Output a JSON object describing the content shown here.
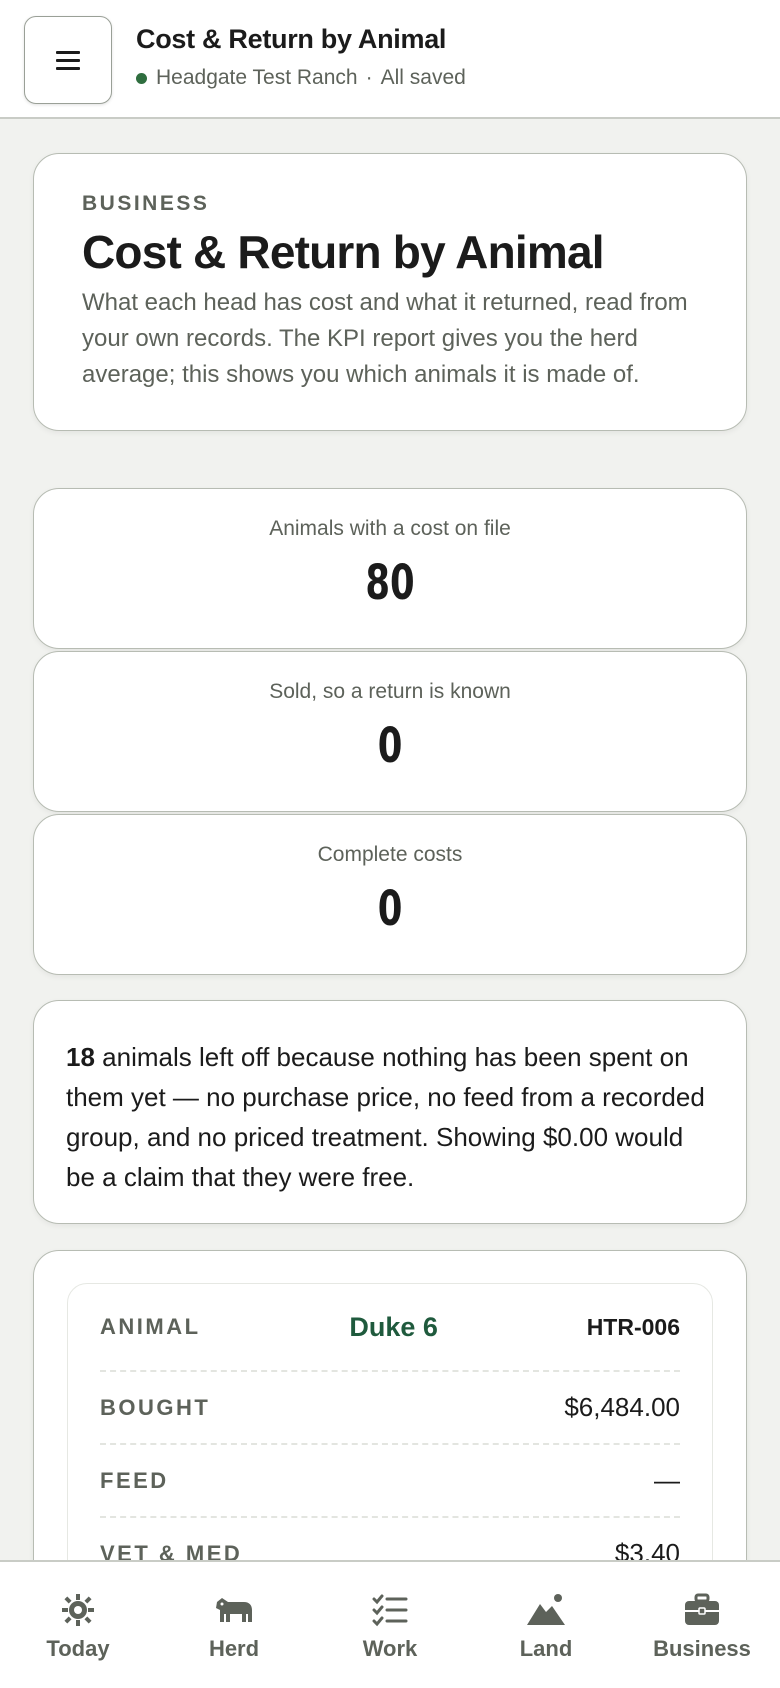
{
  "topbar": {
    "title": "Cost & Return by Animal",
    "ranch": "Headgate Test Ranch",
    "separator": "·",
    "save_status": "All saved",
    "status_color": "#2f6e3f"
  },
  "intro": {
    "eyebrow": "BUSINESS",
    "title": "Cost & Return by Animal",
    "description": "What each head has cost and what it returned, read from your own records. The KPI report gives you the herd average; this shows you which animals it is made of."
  },
  "stats": [
    {
      "label": "Animals with a cost on file",
      "value": "80"
    },
    {
      "label": "Sold, so a return is known",
      "value": "0"
    },
    {
      "label": "Complete costs",
      "value": "0"
    }
  ],
  "note": {
    "count": "18",
    "text": "animals left off because nothing has been spent on them yet — no purchase price, no feed from a recorded group, and no priced treatment. Showing $0.00 would be a claim that they were free."
  },
  "animal_card": {
    "animal_label": "ANIMAL",
    "animal_name": "Duke 6",
    "animal_tag": "HTR-006",
    "rows": [
      {
        "label": "BOUGHT",
        "value": "$6,484.00"
      },
      {
        "label": "FEED",
        "value": "—"
      },
      {
        "label": "VET & MED",
        "value": "$3.40"
      }
    ]
  },
  "nav": [
    {
      "label": "Today",
      "icon": "sun-gear-icon"
    },
    {
      "label": "Herd",
      "icon": "cow-icon"
    },
    {
      "label": "Work",
      "icon": "checklist-icon"
    },
    {
      "label": "Land",
      "icon": "mountain-icon"
    },
    {
      "label": "Business",
      "icon": "briefcase-icon"
    }
  ],
  "colors": {
    "background": "#f1f2ef",
    "accent_green": "#1f5a3d",
    "muted_text": "#5d625a"
  }
}
